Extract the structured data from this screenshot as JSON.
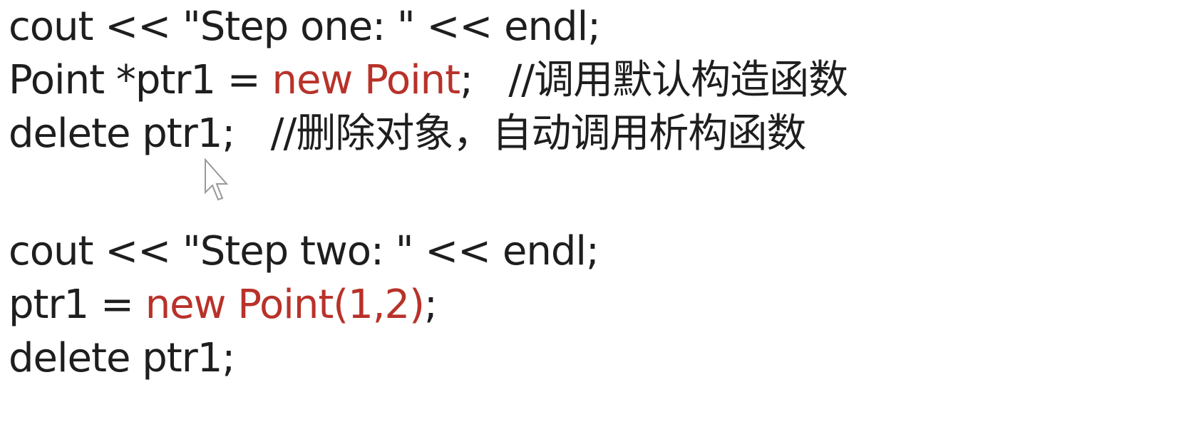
{
  "colors": {
    "text": "#1e1e1e",
    "keyword": "#b8322a"
  },
  "lines": [
    {
      "a": "cout << \"Step one: \" << endl;",
      "r": "",
      "b": ""
    },
    {
      "a": "Point *ptr1 = ",
      "r": "new Point",
      "b": ";   //调用默认构造函数"
    },
    {
      "a": "delete ptr1;   //删除对象，自动调用析构函数",
      "r": "",
      "b": ""
    },
    {
      "a": "cout << \"Step two: \" << endl;",
      "r": "",
      "b": ""
    },
    {
      "a": "ptr1 = ",
      "r": "new Point(1,2)",
      "b": ";"
    },
    {
      "a": "delete ptr1;",
      "r": "",
      "b": ""
    }
  ],
  "cursor_icon": "mouse-pointer-arrow"
}
